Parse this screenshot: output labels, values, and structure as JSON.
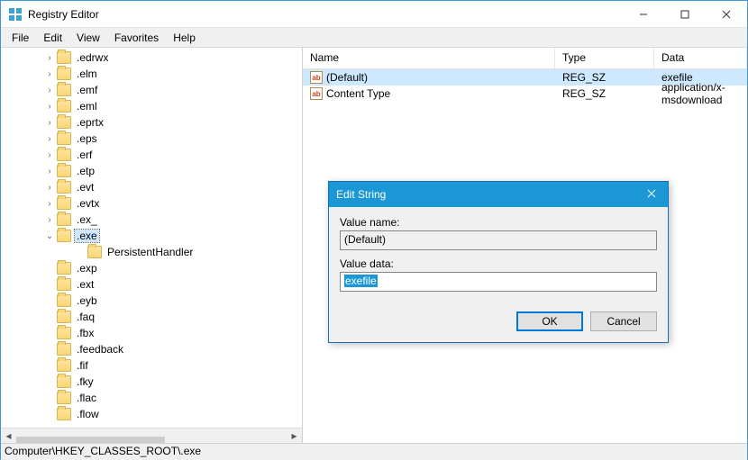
{
  "window": {
    "title": "Registry Editor",
    "min_icon": "minimize-icon",
    "max_icon": "maximize-icon",
    "close_icon": "close-icon"
  },
  "menu": {
    "file": "File",
    "edit": "Edit",
    "view": "View",
    "favorites": "Favorites",
    "help": "Help"
  },
  "tree": {
    "items": [
      {
        "label": ".edrwx",
        "exp": "›"
      },
      {
        "label": ".elm",
        "exp": "›"
      },
      {
        "label": ".emf",
        "exp": "›"
      },
      {
        "label": ".eml",
        "exp": "›"
      },
      {
        "label": ".eprtx",
        "exp": "›"
      },
      {
        "label": ".eps",
        "exp": "›"
      },
      {
        "label": ".erf",
        "exp": "›"
      },
      {
        "label": ".etp",
        "exp": "›"
      },
      {
        "label": ".evt",
        "exp": "›"
      },
      {
        "label": ".evtx",
        "exp": "›"
      },
      {
        "label": ".ex_",
        "exp": "›"
      },
      {
        "label": ".exe",
        "exp": "⌄",
        "selected": true
      },
      {
        "label": "PersistentHandler",
        "exp": "",
        "child": true
      },
      {
        "label": ".exp",
        "exp": ""
      },
      {
        "label": ".ext",
        "exp": ""
      },
      {
        "label": ".eyb",
        "exp": ""
      },
      {
        "label": ".faq",
        "exp": ""
      },
      {
        "label": ".fbx",
        "exp": ""
      },
      {
        "label": ".feedback",
        "exp": ""
      },
      {
        "label": ".fif",
        "exp": ""
      },
      {
        "label": ".fky",
        "exp": ""
      },
      {
        "label": ".flac",
        "exp": ""
      },
      {
        "label": ".flow",
        "exp": ""
      }
    ]
  },
  "list": {
    "columns": {
      "name": "Name",
      "type": "Type",
      "data": "Data"
    },
    "rows": [
      {
        "name": "(Default)",
        "type": "REG_SZ",
        "data": "exefile",
        "selected": true
      },
      {
        "name": "Content Type",
        "type": "REG_SZ",
        "data": "application/x-msdownload"
      }
    ]
  },
  "dialog": {
    "title": "Edit String",
    "value_name_label": "Value name:",
    "value_name": "(Default)",
    "value_data_label": "Value data:",
    "value_data": "exefile",
    "ok": "OK",
    "cancel": "Cancel"
  },
  "status": {
    "path": "Computer\\HKEY_CLASSES_ROOT\\.exe"
  }
}
